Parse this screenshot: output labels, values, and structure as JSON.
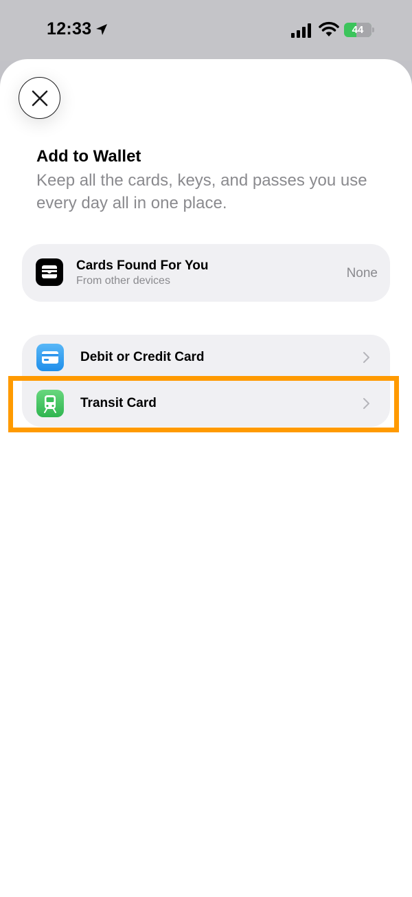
{
  "status_bar": {
    "time": "12:33",
    "battery_level": "44",
    "battery_fraction": 0.44,
    "icons": [
      "location-arrow-icon",
      "cellular-signal-icon",
      "wifi-icon",
      "battery-charging-icon"
    ]
  },
  "sheet": {
    "close_icon": "close-icon",
    "title": "Add to Wallet",
    "subtitle": "Keep all the cards, keys, and passes you use every day all in one place."
  },
  "found_cards": {
    "icon": "wallet-icon",
    "title": "Cards Found For You",
    "subtitle": "From other devices",
    "value": "None"
  },
  "options": [
    {
      "label": "Debit or Credit Card",
      "icon": "credit-card-icon"
    },
    {
      "label": "Transit Card",
      "icon": "train-icon"
    }
  ],
  "colors": {
    "highlight": "#ff9a00",
    "debit_icon": "#2f9cf0",
    "transit_icon": "#3bbf5a",
    "battery": "#3cc45b"
  }
}
